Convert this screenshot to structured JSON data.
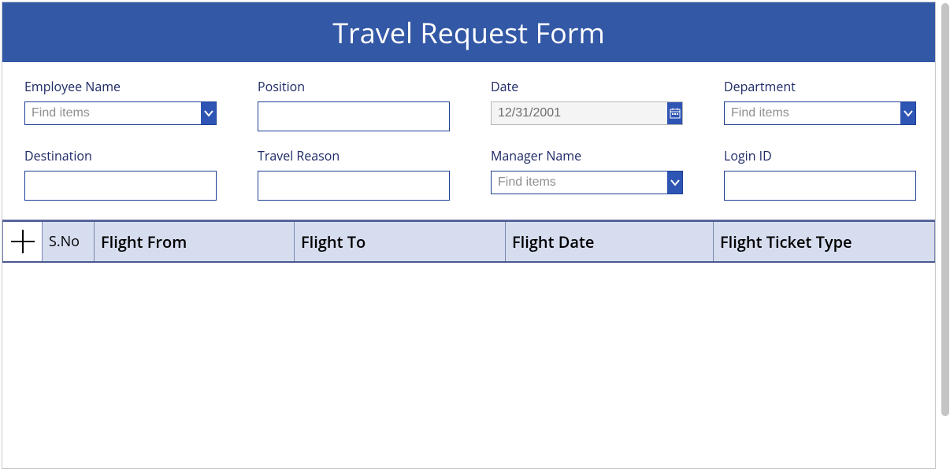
{
  "header": {
    "title": "Travel Request Form"
  },
  "fields": {
    "employee_name": {
      "label": "Employee Name",
      "placeholder": "Find items",
      "value": ""
    },
    "position": {
      "label": "Position",
      "value": ""
    },
    "date": {
      "label": "Date",
      "value": "12/31/2001"
    },
    "department": {
      "label": "Department",
      "placeholder": "Find items",
      "value": ""
    },
    "destination": {
      "label": "Destination",
      "value": ""
    },
    "travel_reason": {
      "label": "Travel Reason",
      "value": ""
    },
    "manager_name": {
      "label": "Manager Name",
      "placeholder": "Find items",
      "value": ""
    },
    "login_id": {
      "label": "Login ID",
      "value": ""
    }
  },
  "table": {
    "columns": {
      "sno": "S.No",
      "from": "Flight From",
      "to": "Flight To",
      "date": "Flight Date",
      "type": "Flight Ticket Type"
    },
    "rows": []
  }
}
